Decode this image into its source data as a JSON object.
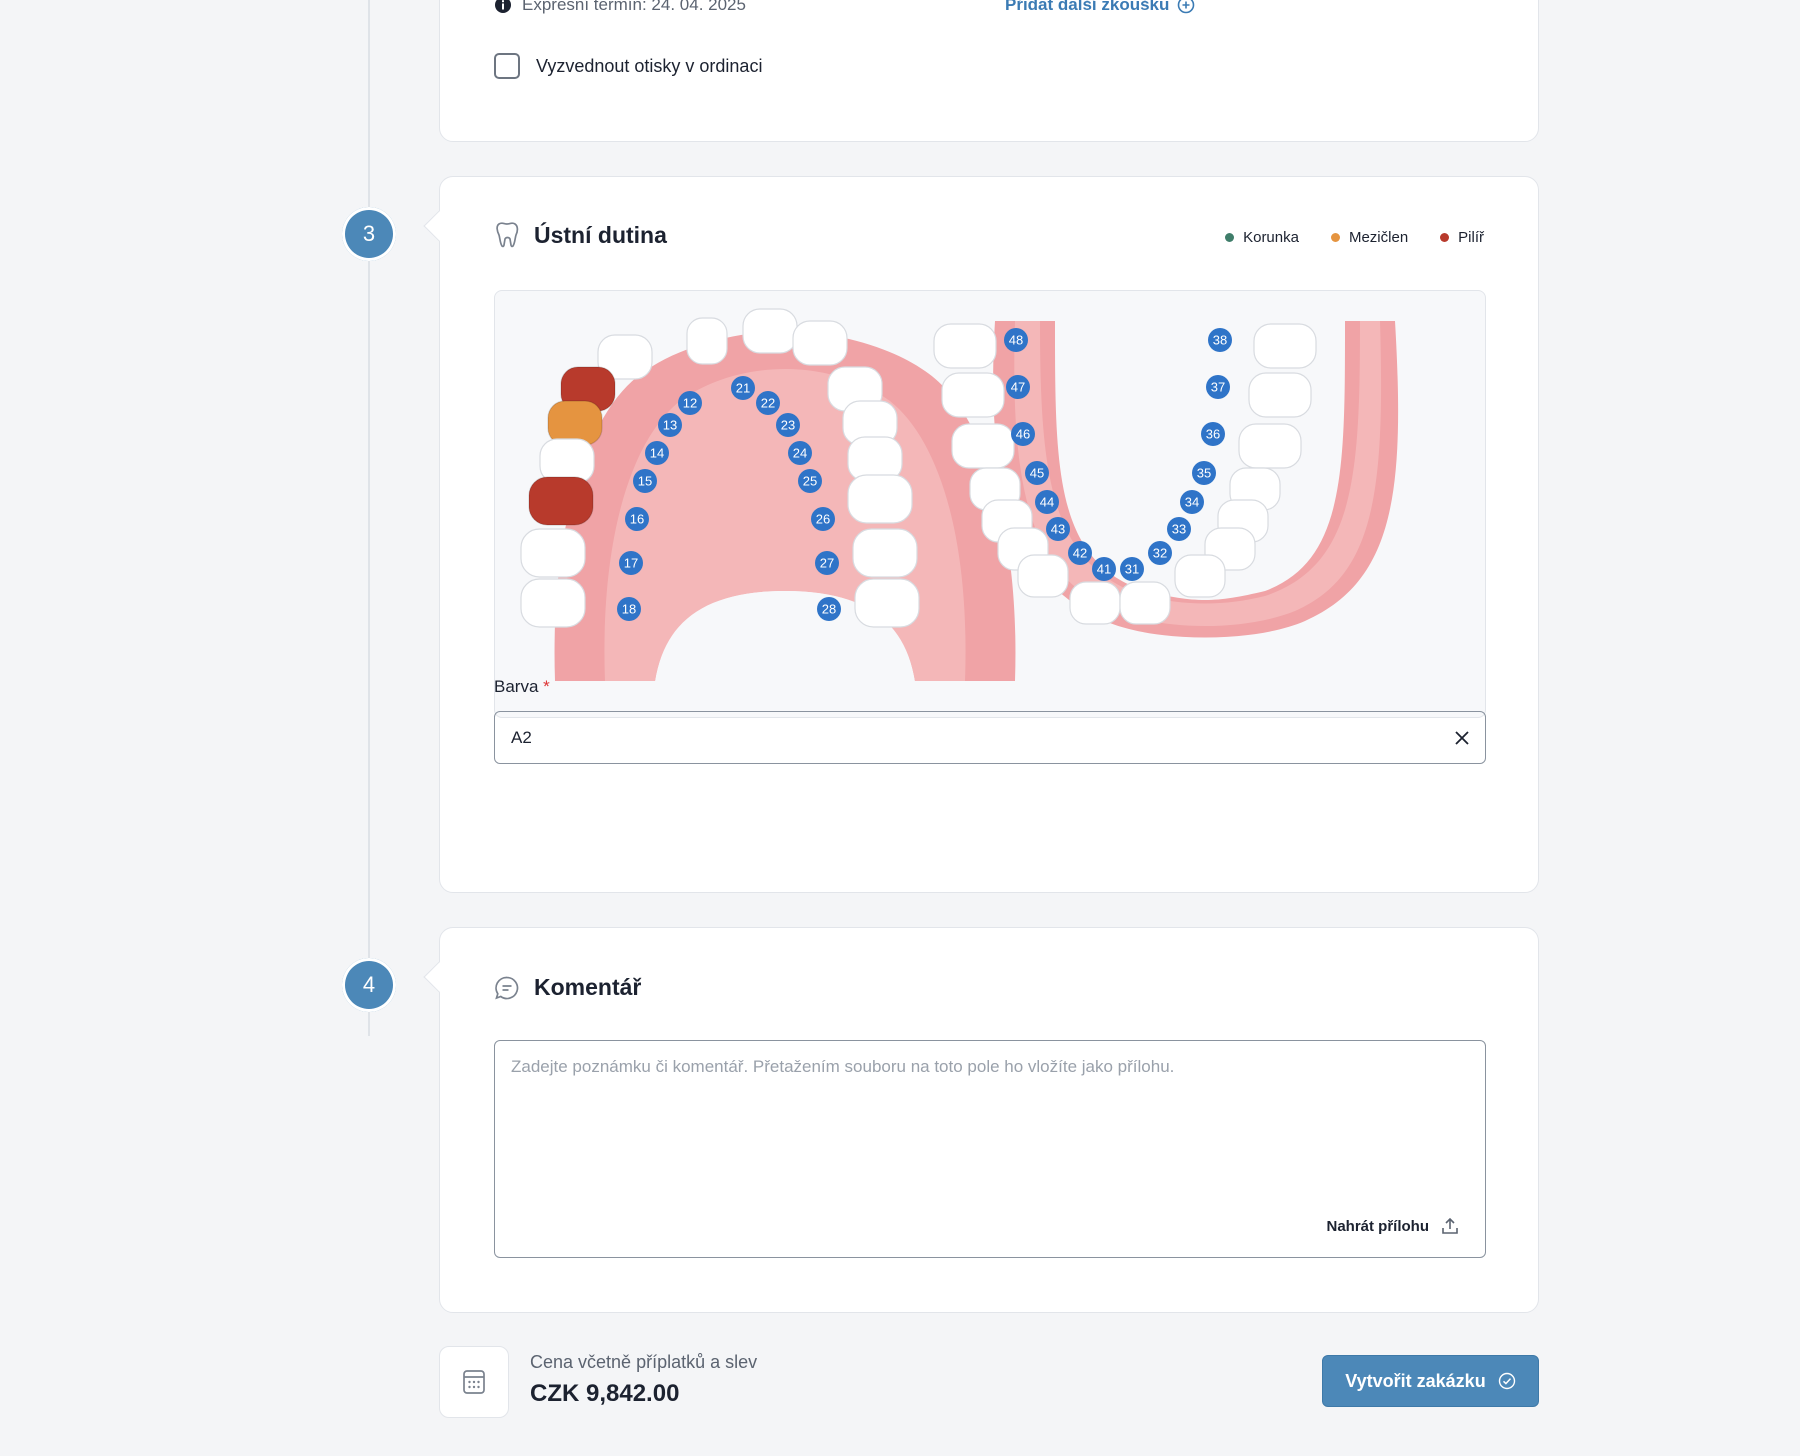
{
  "section2": {
    "express_text": "Expresní termín: 24. 04. 2025",
    "add_fitting_link": "Přidat další zkoušku",
    "pickup_checkbox_label": "Vyzvednout otisky v ordinaci",
    "pickup_checked": false
  },
  "section3": {
    "step_number": "3",
    "title": "Ústní dutina",
    "legend": [
      {
        "label": "Korunka",
        "color": "#3f7d6a"
      },
      {
        "label": "Mezičlen",
        "color": "#e59440"
      },
      {
        "label": "Pilíř",
        "color": "#b83a2c"
      }
    ],
    "upper_teeth": [
      "12",
      "21",
      "22",
      "13",
      "23",
      "14",
      "24",
      "15",
      "25",
      "16",
      "26",
      "17",
      "27",
      "18",
      "28"
    ],
    "lower_teeth": [
      "48",
      "38",
      "47",
      "37",
      "46",
      "36",
      "45",
      "35",
      "44",
      "34",
      "43",
      "33",
      "42",
      "32",
      "41",
      "31"
    ],
    "marked_teeth": {
      "13": "Pilíř",
      "14": "Mezičlen",
      "16": "Pilíř"
    },
    "color_label": "Barva",
    "color_required": "*",
    "color_value": "A2"
  },
  "section4": {
    "step_number": "4",
    "title": "Komentář",
    "comment_placeholder": "Zadejte poznámku či komentář. Přetažením souboru na toto pole ho vložíte jako přílohu.",
    "upload_label": "Nahrát přílohu"
  },
  "footer": {
    "price_label": "Cena včetně příplatků a slev",
    "price_value": "CZK 9,842.00",
    "submit_label": "Vytvořit zakázku"
  }
}
